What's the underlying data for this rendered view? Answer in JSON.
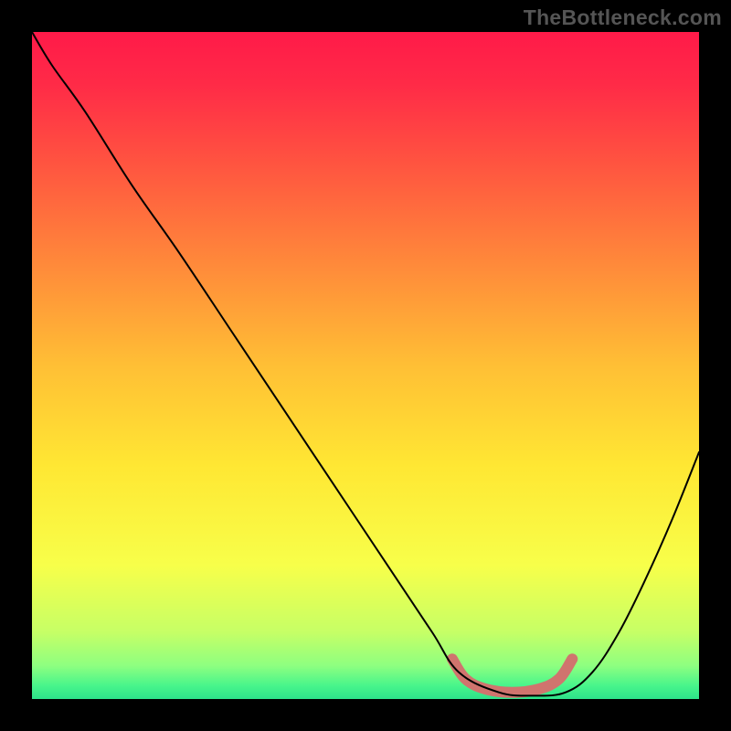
{
  "watermark": "TheBottleneck.com",
  "chart_data": {
    "type": "line",
    "title": "",
    "xlabel": "",
    "ylabel": "",
    "xlim": [
      0,
      100
    ],
    "ylim": [
      0,
      100
    ],
    "background_gradient": {
      "stops": [
        {
          "offset": 0.0,
          "color": "#ff1a49"
        },
        {
          "offset": 0.08,
          "color": "#ff2b47"
        },
        {
          "offset": 0.2,
          "color": "#ff5540"
        },
        {
          "offset": 0.35,
          "color": "#ff8a3a"
        },
        {
          "offset": 0.5,
          "color": "#ffbf35"
        },
        {
          "offset": 0.65,
          "color": "#ffe733"
        },
        {
          "offset": 0.8,
          "color": "#f7ff4a"
        },
        {
          "offset": 0.9,
          "color": "#c6ff66"
        },
        {
          "offset": 0.95,
          "color": "#8eff80"
        },
        {
          "offset": 0.98,
          "color": "#48f58b"
        },
        {
          "offset": 1.0,
          "color": "#2de28a"
        }
      ]
    },
    "series": [
      {
        "name": "bottleneck-curve",
        "color": "#000000",
        "stroke_width": 2.0,
        "x": [
          0,
          3,
          8,
          15,
          22,
          30,
          38,
          46,
          54,
          60,
          64,
          70,
          75,
          80,
          84,
          88,
          92,
          96,
          100
        ],
        "y": [
          100,
          95,
          88,
          77,
          67,
          55,
          43,
          31,
          19,
          10,
          4,
          1,
          0.5,
          1,
          4,
          10,
          18,
          27,
          37
        ]
      }
    ],
    "valley_marker": {
      "name": "optimal-range",
      "color": "#d0746e",
      "stroke_width": 12,
      "linecap": "round",
      "x": [
        63,
        65,
        68,
        72,
        76,
        79,
        81
      ],
      "y": [
        6,
        3,
        1.5,
        1,
        1.5,
        3,
        6
      ]
    }
  }
}
